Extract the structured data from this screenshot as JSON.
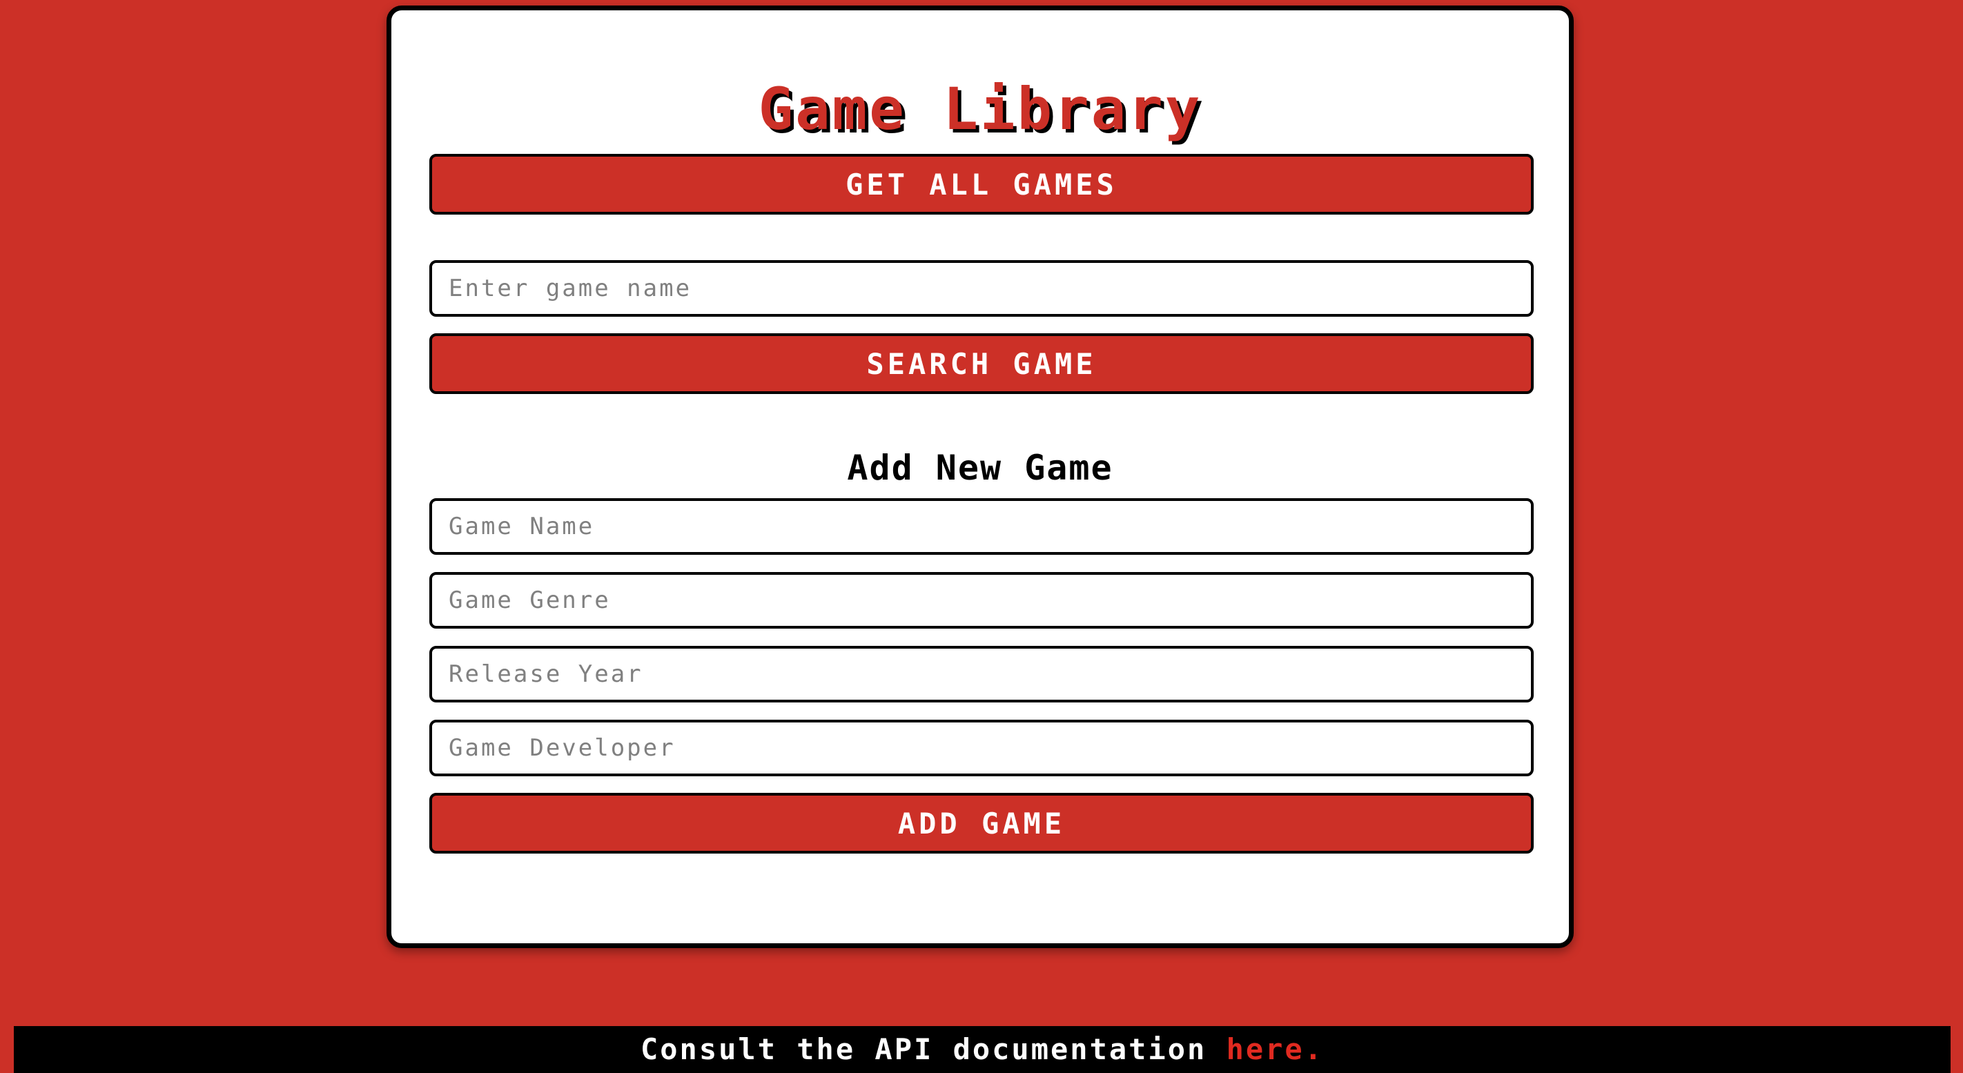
{
  "app": {
    "title": "Game Library"
  },
  "actions": {
    "get_all_label": "GET ALL GAMES",
    "search_label": "SEARCH GAME",
    "add_label": "ADD GAME"
  },
  "search": {
    "placeholder": "Enter game name",
    "value": ""
  },
  "add_form": {
    "title": "Add New Game",
    "fields": {
      "name": {
        "placeholder": "Game Name",
        "value": ""
      },
      "genre": {
        "placeholder": "Game Genre",
        "value": ""
      },
      "year": {
        "placeholder": "Release Year",
        "value": ""
      },
      "developer": {
        "placeholder": "Game Developer",
        "value": ""
      }
    }
  },
  "footer": {
    "text": "Consult the API documentation ",
    "link_text": "here."
  },
  "colors": {
    "background": "#cc3027",
    "accent": "#cc3027",
    "link": "#e02a20",
    "card": "#ffffff",
    "footer": "#000000"
  }
}
